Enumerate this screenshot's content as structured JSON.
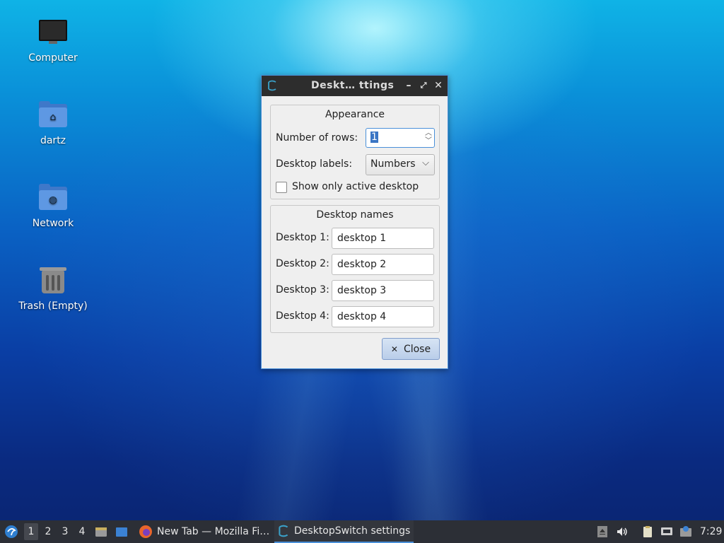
{
  "desktop": {
    "icons": [
      {
        "label": "Computer",
        "icon": "computer-icon"
      },
      {
        "label": "dartz",
        "icon": "home-folder-icon"
      },
      {
        "label": "Network",
        "icon": "network-folder-icon"
      },
      {
        "label": "Trash (Empty)",
        "icon": "trash-icon"
      }
    ]
  },
  "dialog": {
    "title": "Deskt… ttings",
    "appearance": {
      "title": "Appearance",
      "rows_label": "Number of rows:",
      "rows_value": "1",
      "labels_label": "Desktop labels:",
      "labels_value": "Numbers",
      "show_active_label": "Show only active desktop",
      "show_active_checked": false
    },
    "names": {
      "title": "Desktop names",
      "items": [
        {
          "label": "Desktop 1:",
          "value": "desktop 1"
        },
        {
          "label": "Desktop 2:",
          "value": "desktop 2"
        },
        {
          "label": "Desktop 3:",
          "value": "desktop 3"
        },
        {
          "label": "Desktop 4:",
          "value": "desktop 4"
        }
      ]
    },
    "close_label": "Close"
  },
  "taskbar": {
    "desktops": [
      "1",
      "2",
      "3",
      "4"
    ],
    "active_desktop": "1",
    "tasks": [
      {
        "label": "New Tab — Mozilla Fi…",
        "icon": "firefox-icon"
      },
      {
        "label": "DesktopSwitch settings",
        "icon": "desktopswitch-icon"
      }
    ],
    "clock": "7:29"
  },
  "colors": {
    "accent": "#4a90d9",
    "taskbar": "#2c2f36",
    "titlebar": "#2d2d2d"
  }
}
